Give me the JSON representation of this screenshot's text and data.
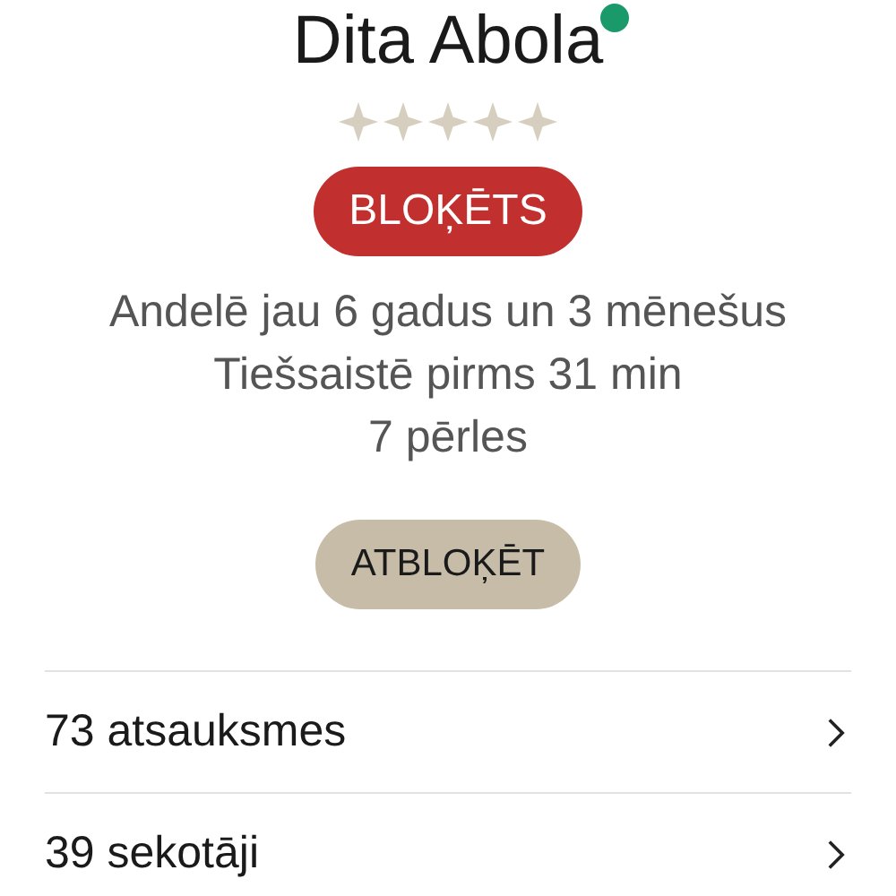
{
  "profile": {
    "name": "Dita Abola",
    "online": true,
    "stars": 0
  },
  "status_badge": "BLOĶĒTS",
  "info_lines": [
    "Andelē jau 6 gadus un 3 mēnešus",
    "Tiešsaistē pirms 31 min",
    "7 pērles"
  ],
  "unblock_button": "ATBLOĶĒT",
  "links": [
    {
      "label": "73 atsauksmes"
    },
    {
      "label": "39 sekotāji"
    }
  ]
}
